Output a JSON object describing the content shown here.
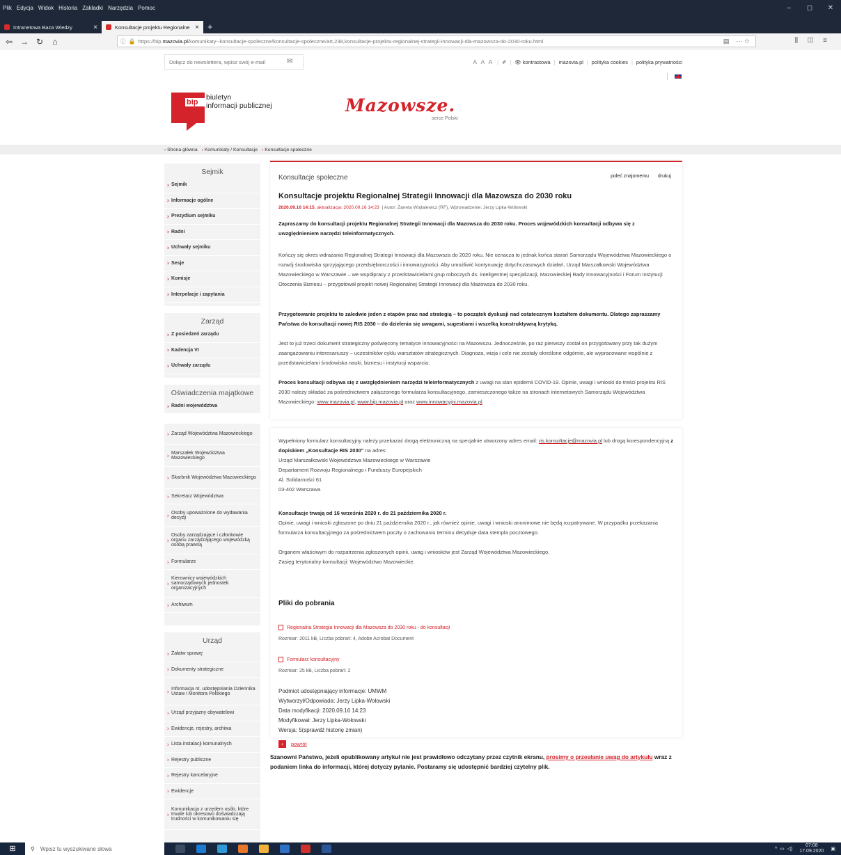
{
  "browser": {
    "menu": [
      "Plik",
      "Edycja",
      "Widok",
      "Historia",
      "Zakładki",
      "Narzędzia",
      "Pomoc"
    ],
    "tabs": [
      {
        "title": "Intranetowa Baza Wiedzy",
        "active": false
      },
      {
        "title": "Konsultacje projektu Regionalne",
        "active": true
      }
    ],
    "url_prefix": "https://bip.",
    "url_domain": "mazovia.pl",
    "url_rest": "/komunikaty--konsultacje-spoleczne/konsultacje-spoleczne/art,238,konsultacje-projektu-regionalnej-strategii-innowacji-dla-mazowsza-do-2030-roku.html"
  },
  "top": {
    "newsletter_placeholder": "Dołącz do newslettera, wpisz swój e-mail",
    "aaa": "A A A",
    "kontrastowa": "kontrastowa",
    "mazovia": "mazovia.pl",
    "cookies": "polityka cookies",
    "prywatnosc": "polityka prywatności"
  },
  "logo": {
    "bip": "bip",
    "line1": "biuletyn",
    "line2": "informacji publicznej",
    "mazowsze": "Mazowsze.",
    "serce": "serce Polski"
  },
  "breadcrumb": [
    "Strona główna",
    "Komunikaty / Konsultacje",
    "Konsultacje społeczne"
  ],
  "sidebar": {
    "sejmik_title": "Sejmik",
    "sejmik": [
      "Sejmik",
      "Informacje ogólne",
      "Prezydium sejmiku",
      "Radni",
      "Uchwały sejmiku",
      "Sesje",
      "Komisje",
      "Interpelacje i zapytania"
    ],
    "zarzad_title": "Zarząd",
    "zarzad": [
      "Z posiedzeń zarządu",
      "Kadencja VI",
      "Uchwały zarządu"
    ],
    "osw_title": "Oświadczenia majątkowe",
    "osw": [
      "Radni województwa",
      "Zarząd Województwa Mazowieckiego",
      "Marszałek Województwa Mazowieckiego",
      "Skarbnik Województwa Mazowieckiego",
      "Sekretarz Województwa",
      "Osoby upoważnione do wydawania decyzji",
      "Osoby zarządzające i członkowie organu zarządzającego wojewódzką osobą prawną",
      "Formularze",
      "Kierownicy wojewódzkich samorządowych jednostek organizacyjnych",
      "Archiwum"
    ],
    "urzad_title": "Urząd",
    "urzad": [
      "Załatw sprawę",
      "Dokumenty strategiczne",
      "Informacja nt. udostępniania Dziennika Ustaw i Monitora Polskiego",
      "Urząd przyjazny obywatelowi",
      "Ewidencje, rejestry, archiwa",
      "Lista instalacji komunalnych",
      "Rejestry publiczne",
      "Rejestry kancelaryjne",
      "Ewidencje",
      "Komunikacja z urzędem osób, które trwale lub okresowo doświadczają trudności w komunikowaniu się"
    ]
  },
  "article": {
    "category": "Konsultacje społeczne",
    "polec": "poleć znajomemu",
    "drukuj": "drukuj",
    "title": "Konsultacje projektu Regionalnej Strategii Innowacji dla Mazowsza do 2030 roku",
    "date": "2020.09.16 14:15",
    "updated": ", aktualizacja: 2020.09.16 14:23",
    "author": "| Autor: Żaneta Wojtalewicz (RF), Wprowadzenie: Jerzy Lipka-Wołowski",
    "lead": "Zapraszamy do konsultacji projektu Regionalnej Strategii Innowacji dla Mazowsza do 2030 roku. Proces wojewódzkich konsultacji odbywa się z uwzględnieniem narzędzi teleinformatycznych.",
    "p1": "Kończy się okres wdrażania Regionalnej Strategii Innowacji dla Mazowsza do 2020 roku. Nie oznacza to jednak końca starań Samorządu Województwa Mazowieckiego o rozwój środowiska sprzyjającego przedsiębiorczości i innowacyjności. Aby umożliwić kontynuację dotychczasowych działań, Urząd Marszałkowski Województwa Mazowieckiego w Warszawie – we współpracy z przedstawicielami grup roboczych ds. inteligentnej specjalizacji, Mazowieckiej Rady Innowacyjności i Forum Instytucji Otoczenia Biznesu – przygotował projekt nowej Regionalnej Strategii Innowacji dla Mazowsza do 2030 roku.",
    "p2": "Przygotowanie projektu to zaledwie jeden z etapów prac nad strategią – to początek dyskusji nad ostatecznym kształtem dokumentu. Dlatego zapraszamy Państwa do konsultacji nowej RIS 2030 – do dzielenia się uwagami, sugestiami i wszelką konstruktywną krytyką.",
    "p3": "Jest to już trzeci dokument strategiczny poświęcony tematyce innowacyjności na Mazowszu. Jednocześnie, po raz pierwszy został on przygotowany przy tak dużym zaangażowaniu interesariuszy – uczestników cyklu warsztatów strategicznych. Diagnoza, wizja i cele nie zostały określone odgórnie, ale wypracowane wspólnie z przedstawicielami środowiska nauki, biznesu i instytucji wsparcia.",
    "p4_bold": "Proces konsultacji odbywa się z uwzględnieniem narzędzi teleinformatycznych",
    "p4_rest": " z uwagi na stan epidemii COVID-19. Opinie, uwagi i wnioski do treści projektu RIS 2030 należy składać za pośrednictwem załączonego formularza konsultacyjnego, zamieszczonego także na stronach internetowych Samorządu Województwa Mazowieckiego: ",
    "link1": "www.mazovia.pl",
    "comma": ", ",
    "link2": "www.bip.mazovia.pl",
    "oraz": " oraz ",
    "link3": "www.innowacyjni.mazovia.pl",
    "dot": ".",
    "p5a": "Wypełniony formularz konsultacyjny należy przekazać drogą elektroniczną na specjalnie utworzony adres email: ",
    "email": "ris.konsultacje@mazovia.pl",
    "p5b": " lub drogą korespondencyjną ",
    "p5c": "z dopiskiem „Konsultacje RIS 2030\"",
    "p5d": " na adres:",
    "addr": [
      "Urząd Marszałkowski Województwa Mazowieckiego w Warszawie",
      "Departament Rozwoju Regionalnego i Funduszy Europejskich",
      "Al. Solidarności 61",
      "03-402 Warszawa"
    ],
    "term_bold": "Konsultacje trwają od 16 września 2020 r. do 21 października 2020 r.",
    "term": "Opinie, uwagi i wnioski zgłoszone po dniu 21 października 2020 r., jak również opinie, uwagi i wnioski  anonimowe nie będą rozpatrywane. W przypadku przekazania formularza konsultacyjnego za pośrednictwem poczty o zachowaniu terminu decyduje data stempla pocztowego.",
    "organ1": "Organem właściwym do rozpatrzenia zgłoszonych opinii, uwag i wniosków jest Zarząd Województwa Mazowieckiego.",
    "organ2": "Zasięg terytorialny konsultacji: Województwo Mazowieckie.",
    "pliki": "Pliki do pobrania",
    "file1": "Regionalna Strategia Innowacji dla Mazowsza do 2030 roku - do konsultacji",
    "file1_meta": "Rozmiar: 2011 kB, Liczba pobrań: 4, Adobe Acrobat Document",
    "file2": "Formularz konsultacyjny",
    "file2_meta": "Rozmiar: 25 kB, Liczba pobrań: 2",
    "meta": [
      "Podmiot udostępniający informacje: UMWM",
      "Wytworzył/Odpowiada: Jerzy Lipka-Wołowski",
      "Data modyfikacji: 2020.09.16 14:23",
      "Modyfikował: Jerzy Lipka-Wołowski",
      "Wersja: 5(sprawdź historię zmian)"
    ],
    "back": "powrót"
  },
  "footer": {
    "a": "Szanowni Państwo, jeżeli opublikowany artykuł nie jest prawidłowo odczytany przez czytnik ekranu, ",
    "link": "prosimy o przesłanie uwag do artykułu",
    "b": " wraz z podaniem linka do informacji, której dotyczy pytanie. Postaramy się udostępnić bardziej czytelny plik."
  },
  "taskbar": {
    "search": "Wpisz tu wyszukiwane słowa",
    "time": "07:08",
    "date": "17.09.2020"
  }
}
